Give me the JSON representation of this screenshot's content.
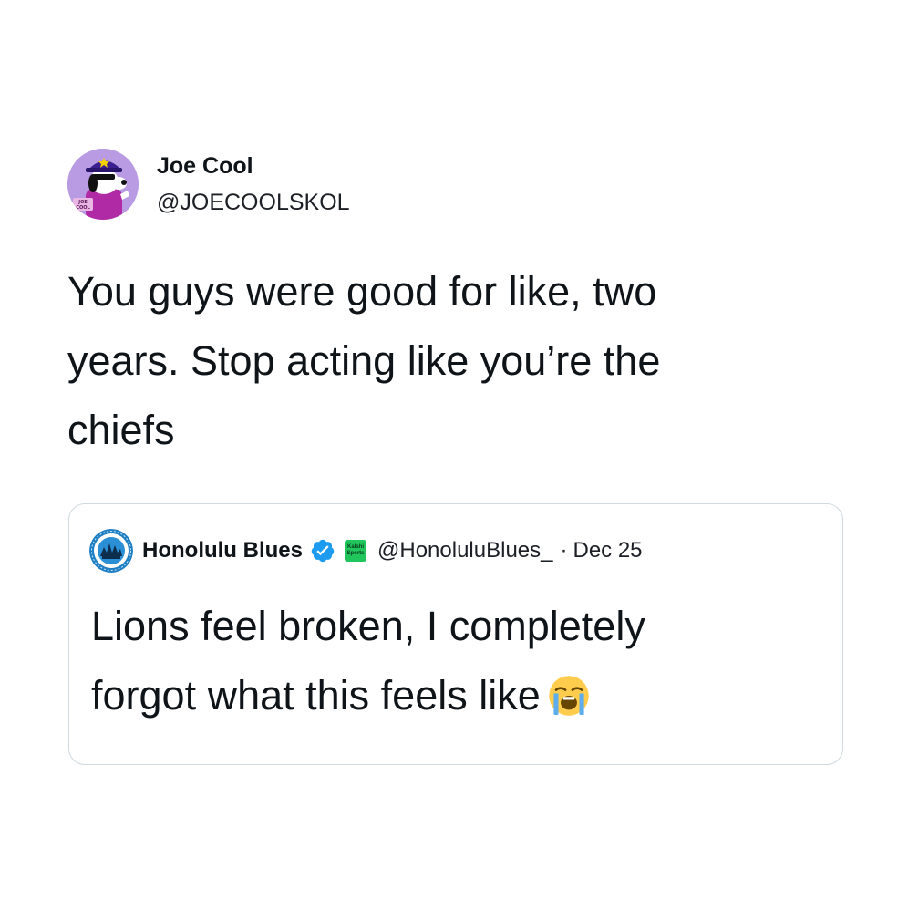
{
  "tweet": {
    "author_name": "Joe Cool",
    "author_handle": "@JOECOOLSKOL",
    "avatar_icon": "snoopy-joe-cool-avatar",
    "avatar_badge_text": "JOE COOL",
    "text": "You guys were good for like, two\nyears. Stop acting like you’re the\nchiefs"
  },
  "quoted_tweet": {
    "author_name": "Honolulu Blues",
    "avatar_icon": "honolulu-blues-logo",
    "avatar_ring_text": "HONOLULU BLUES",
    "verified_icon": "verified-badge-icon",
    "affiliate_label_top": "Kalshi",
    "affiliate_label_bottom": "Sports",
    "handle": "@HonoluluBlues_",
    "separator": "·",
    "date": "Dec 25",
    "text_main": "Lions feel broken, I completely\nforgot what this feels like",
    "emoji_icon": "loudly-crying-face-emoji"
  },
  "colors": {
    "text_primary": "#0f1419",
    "border": "#cfd9de",
    "verified_blue": "#1d9bf0",
    "avatar_purple": "#a98bd8",
    "logo_blue": "#1f7fc4",
    "affiliate_green": "#20c55c"
  }
}
